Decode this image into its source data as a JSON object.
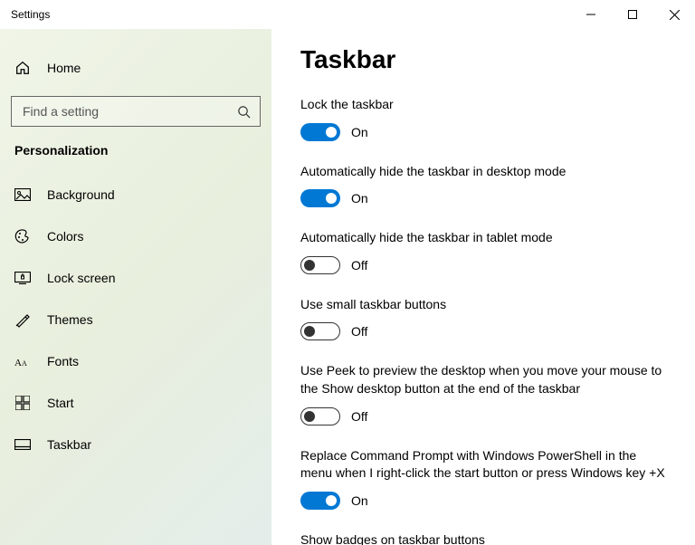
{
  "window": {
    "title": "Settings"
  },
  "sidebar": {
    "home_label": "Home",
    "search_placeholder": "Find a setting",
    "category": "Personalization",
    "items": [
      {
        "label": "Background"
      },
      {
        "label": "Colors"
      },
      {
        "label": "Lock screen"
      },
      {
        "label": "Themes"
      },
      {
        "label": "Fonts"
      },
      {
        "label": "Start"
      },
      {
        "label": "Taskbar"
      }
    ]
  },
  "page": {
    "title": "Taskbar",
    "on_text": "On",
    "off_text": "Off",
    "settings": [
      {
        "label": "Lock the taskbar",
        "on": true
      },
      {
        "label": "Automatically hide the taskbar in desktop mode",
        "on": true
      },
      {
        "label": "Automatically hide the taskbar in tablet mode",
        "on": false
      },
      {
        "label": "Use small taskbar buttons",
        "on": false
      },
      {
        "label": "Use Peek to preview the desktop when you move your mouse to the Show desktop button at the end of the taskbar",
        "on": false
      },
      {
        "label": "Replace Command Prompt with Windows PowerShell in the menu when I right-click the start button or press Windows key +X",
        "on": true
      },
      {
        "label": "Show badges on taskbar buttons",
        "on": true
      }
    ]
  }
}
